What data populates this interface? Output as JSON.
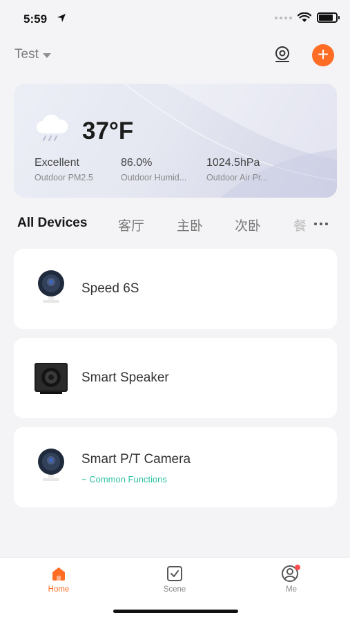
{
  "status_bar": {
    "time": "5:59"
  },
  "header": {
    "home_name": "Test"
  },
  "weather": {
    "temperature": "37°F",
    "metrics": [
      {
        "value": "Excellent",
        "label": "Outdoor PM2.5"
      },
      {
        "value": "86.0%",
        "label": "Outdoor Humid..."
      },
      {
        "value": "1024.5hPa",
        "label": "Outdoor Air Pr..."
      }
    ]
  },
  "tabs": [
    "All Devices",
    "客厅",
    "主卧",
    "次卧",
    "餐"
  ],
  "devices": [
    {
      "name": "Speed 6S",
      "icon": "camera-icon"
    },
    {
      "name": "Smart Speaker",
      "icon": "speaker-icon"
    },
    {
      "name": "Smart P/T Camera",
      "icon": "camera-icon",
      "subtitle": "~ Common Functions"
    }
  ],
  "tabbar": {
    "items": [
      {
        "label": "Home",
        "icon": "home-icon",
        "active": true
      },
      {
        "label": "Scene",
        "icon": "scene-icon",
        "active": false
      },
      {
        "label": "Me",
        "icon": "profile-icon",
        "active": false
      }
    ]
  },
  "colors": {
    "accent": "#ff6c23",
    "sub_link": "#2fc2a3"
  }
}
